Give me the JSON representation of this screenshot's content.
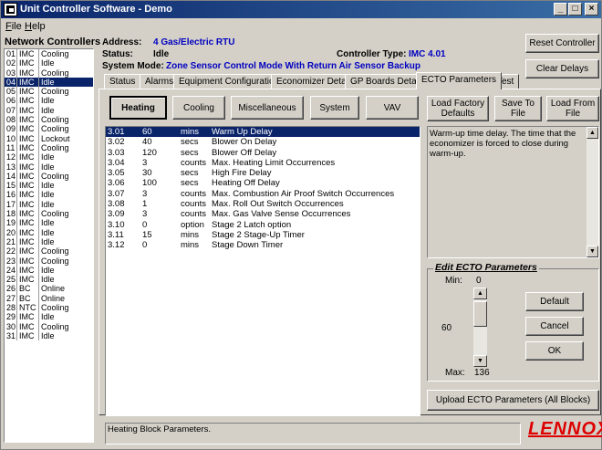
{
  "window": {
    "title": "Unit Controller Software - Demo"
  },
  "menu": [
    {
      "label": "File"
    },
    {
      "label": "Help"
    }
  ],
  "network": {
    "title": "Network Controllers",
    "rows": [
      [
        "01",
        "IMC",
        "Cooling"
      ],
      [
        "02",
        "IMC",
        "Idle"
      ],
      [
        "03",
        "IMC",
        "Cooling"
      ],
      [
        "04",
        "IMC",
        "Idle"
      ],
      [
        "05",
        "IMC",
        "Cooling"
      ],
      [
        "06",
        "IMC",
        "Idle"
      ],
      [
        "07",
        "IMC",
        "Idle"
      ],
      [
        "08",
        "IMC",
        "Cooling"
      ],
      [
        "09",
        "IMC",
        "Cooling"
      ],
      [
        "10",
        "IMC",
        "Lockout"
      ],
      [
        "11",
        "IMC",
        "Cooling"
      ],
      [
        "12",
        "IMC",
        "Idle"
      ],
      [
        "13",
        "IMC",
        "Idle"
      ],
      [
        "14",
        "IMC",
        "Cooling"
      ],
      [
        "15",
        "IMC",
        "Idle"
      ],
      [
        "16",
        "IMC",
        "Idle"
      ],
      [
        "17",
        "IMC",
        "Idle"
      ],
      [
        "18",
        "IMC",
        "Cooling"
      ],
      [
        "19",
        "IMC",
        "Idle"
      ],
      [
        "20",
        "IMC",
        "Idle"
      ],
      [
        "21",
        "IMC",
        "Idle"
      ],
      [
        "22",
        "IMC",
        "Cooling"
      ],
      [
        "23",
        "IMC",
        "Cooling"
      ],
      [
        "24",
        "IMC",
        "Idle"
      ],
      [
        "25",
        "IMC",
        "Idle"
      ],
      [
        "26",
        "BC",
        "Online"
      ],
      [
        "27",
        "BC",
        "Online"
      ],
      [
        "28",
        "NTC",
        "Cooling"
      ],
      [
        "29",
        "IMC",
        "Idle"
      ],
      [
        "30",
        "IMC",
        "Cooling"
      ],
      [
        "31",
        "IMC",
        "Idle"
      ]
    ],
    "selected_index": 3
  },
  "header": {
    "address_label": "Address:",
    "address_value": "4 Gas/Electric RTU",
    "status_label": "Status:",
    "status_value": "Idle",
    "controller_type_label": "Controller Type:",
    "controller_type_value": "IMC 4.01",
    "system_mode_label": "System Mode:",
    "system_mode_value": "Zone Sensor Control Mode With Return Air Sensor Backup",
    "reset_label": "Reset Controller",
    "clear_delays_label": "Clear Delays"
  },
  "tabs": [
    {
      "label": "Status"
    },
    {
      "label": "Alarms"
    },
    {
      "label": "Equipment Configuration"
    },
    {
      "label": "Economizer Detail"
    },
    {
      "label": "GP Boards Detail"
    },
    {
      "label": "ECTO Parameters"
    },
    {
      "label": "Test"
    }
  ],
  "active_tab": "ECTO Parameters",
  "blocks": {
    "heating": "Heating",
    "cooling": "Cooling",
    "misc": "Miscellaneous",
    "system": "System",
    "vav": "VAV"
  },
  "actions": {
    "load_factory": "Load Factory Defaults",
    "save_to_file": "Save To File",
    "load_from_file": "Load From File"
  },
  "parameters": [
    [
      "3.01",
      "60",
      "mins",
      "Warm Up Delay"
    ],
    [
      "3.02",
      "40",
      "secs",
      "Blower On Delay"
    ],
    [
      "3.03",
      "120",
      "secs",
      "Blower Off Delay"
    ],
    [
      "3.04",
      "3",
      "counts",
      "Max. Heating Limit Occurrences"
    ],
    [
      "3.05",
      "30",
      "secs",
      "High Fire Delay"
    ],
    [
      "3.06",
      "100",
      "secs",
      "Heating Off Delay"
    ],
    [
      "3.07",
      "3",
      "counts",
      "Max. Combustion Air Proof Switch Occurrences"
    ],
    [
      "3.08",
      "1",
      "counts",
      "Max. Roll Out Switch Occurrences"
    ],
    [
      "3.09",
      "3",
      "counts",
      "Max. Gas Valve Sense Occurrences"
    ],
    [
      "3.10",
      "0",
      "option",
      "Stage 2 Latch option"
    ],
    [
      "3.11",
      "15",
      "mins",
      "Stage 2 Stage-Up Timer"
    ],
    [
      "3.12",
      "0",
      "mins",
      "Stage Down Timer"
    ]
  ],
  "description": "Warm-up time delay. The time that the economizer is forced to close during warm-up.",
  "edit": {
    "title": "Edit ECTO Parameters",
    "min_label": "Min:",
    "min_value": "0",
    "max_label": "Max:",
    "max_value": "136",
    "current_value": "60",
    "default_label": "Default",
    "cancel_label": "Cancel",
    "ok_label": "OK"
  },
  "upload_label": "Upload ECTO Parameters (All Blocks)",
  "status_text": "Heating Block Parameters.",
  "logo_text": "LENNOX",
  "colors": {
    "accent": "#0a246a",
    "value_blue": "#0000c0",
    "logo_red": "#dd0000"
  }
}
